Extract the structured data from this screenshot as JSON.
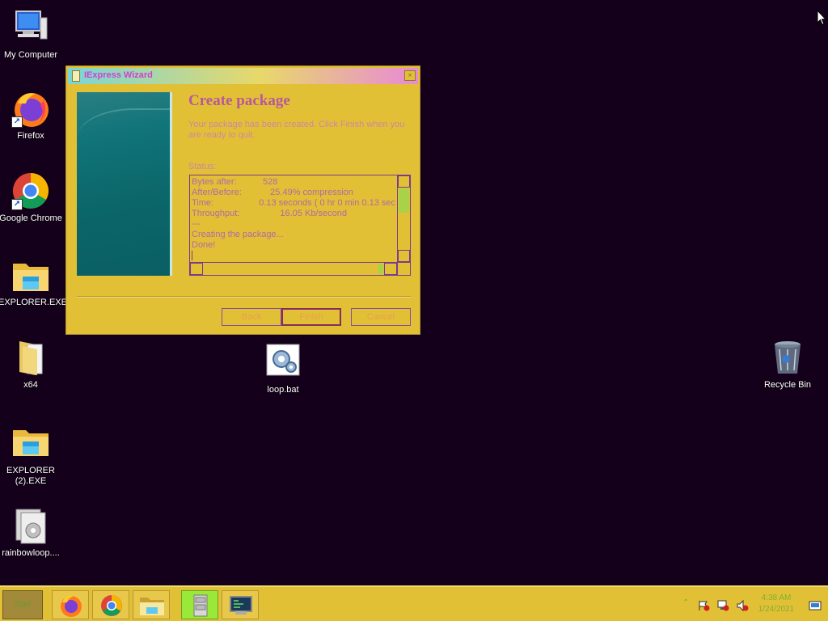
{
  "desktop": {
    "icons": [
      {
        "label": "My Computer"
      },
      {
        "label": "Firefox"
      },
      {
        "label": "Google Chrome"
      },
      {
        "label": "EXPLORER.EXE"
      },
      {
        "label": "x64"
      },
      {
        "label": "EXPLORER (2).EXE"
      },
      {
        "label": "rainbowloop...."
      },
      {
        "label": "loop.bat"
      },
      {
        "label": "Recycle Bin"
      }
    ]
  },
  "dialog": {
    "title": "IExpress Wizard",
    "close_glyph": "×",
    "heading": "Create package",
    "description": "Your package has been created.  Click Finish when you are ready to quit.",
    "status_label": "Status:",
    "status_rows": [
      {
        "key": "Bytes after:",
        "value": "528"
      },
      {
        "key": "After/Before:",
        "value": "   25.49% compression"
      },
      {
        "key": "Time:",
        "value": "0.13 seconds ( 0 hr  0 min  0.13 sec"
      },
      {
        "key": "Throughput:",
        "value": "       16.05 Kb/second"
      }
    ],
    "status_lines": [
      "---",
      "Creating the package...",
      "Done!"
    ],
    "buttons": {
      "back": "Back",
      "finish": "Finish",
      "cancel": "Cancel"
    }
  },
  "taskbar": {
    "start_label": "Start",
    "clock_time": "4:38 AM",
    "clock_date": "1/24/2021"
  },
  "colors": {
    "desktop": "#14001a",
    "dialog": "#e2c036",
    "accent_heading": "#b8589c"
  }
}
